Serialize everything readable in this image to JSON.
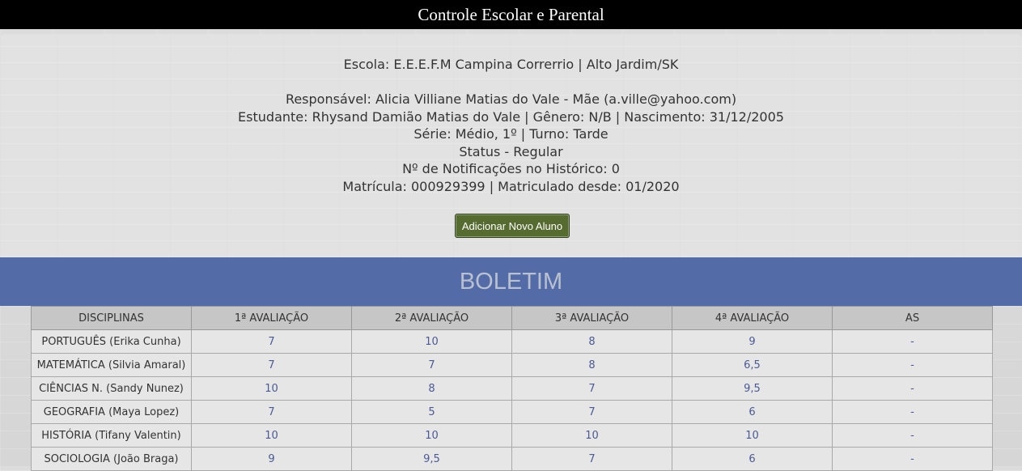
{
  "app": {
    "title": "Controle Escolar e Parental"
  },
  "student_info": {
    "school": "Escola: E.E.E.F.M Campina Correrrio | Alto Jardim/SK",
    "responsible": "Responsável: Alicia Villiane Matias do Vale - Mãe (a.ville@yahoo.com)",
    "student": "Estudante: Rhysand Damião Matias do Vale | Gênero: N/B | Nascimento: 31/12/2005",
    "grade": "Série: Médio, 1º | Turno: Tarde",
    "status": "Status - Regular",
    "notifications": "Nº de Notificações no Histórico: 0",
    "enrollment": "Matrícula: 000929399 | Matriculado desde: 01/2020"
  },
  "actions": {
    "add_student_label": "Adicionar Novo Aluno"
  },
  "report_card": {
    "title": "BOLETIM",
    "headers": [
      "DISCIPLINAS",
      "1ª AVALIAÇÃO",
      "2ª AVALIAÇÃO",
      "3ª AVALIAÇÃO",
      "4ª AVALIAÇÃO",
      "AS"
    ],
    "rows": [
      [
        "PORTUGUÊS (Erika Cunha)",
        "7",
        "10",
        "8",
        "9",
        "-"
      ],
      [
        "MATEMÁTICA (Silvia Amaral)",
        "7",
        "7",
        "8",
        "6,5",
        "-"
      ],
      [
        "CIÊNCIAS N. (Sandy Nunez)",
        "10",
        "8",
        "7",
        "9,5",
        "-"
      ],
      [
        "GEOGRAFIA (Maya Lopez)",
        "7",
        "5",
        "7",
        "6",
        "-"
      ],
      [
        "HISTÓRIA (Tifany Valentin)",
        "10",
        "10",
        "10",
        "10",
        "-"
      ],
      [
        "SOCIOLOGIA (João Braga)",
        "9",
        "9,5",
        "7",
        "6",
        "-"
      ]
    ]
  },
  "colors": {
    "header_bar": "#000000",
    "boletim_bar": "#536ca8",
    "button": "#556b2f",
    "grade_text": "#4a5a93"
  }
}
